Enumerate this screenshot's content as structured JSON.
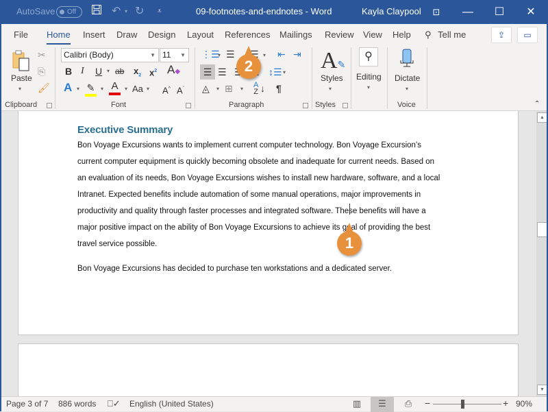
{
  "titlebar": {
    "autosave_label": "AutoSave",
    "autosave_state": "Off",
    "document_title": "09-footnotes-and-endnotes - Word",
    "user_name": "Kayla Claypool",
    "icons": [
      "save-icon",
      "undo-icon",
      "redo-icon",
      "customize-qat-icon",
      "ribbon-display-icon",
      "minimize-icon",
      "maximize-icon",
      "close-icon"
    ]
  },
  "tabs": [
    {
      "label": "File"
    },
    {
      "label": "Home",
      "active": true
    },
    {
      "label": "Insert"
    },
    {
      "label": "Draw"
    },
    {
      "label": "Design"
    },
    {
      "label": "Layout"
    },
    {
      "label": "References"
    },
    {
      "label": "Mailings"
    },
    {
      "label": "Review"
    },
    {
      "label": "View"
    },
    {
      "label": "Help"
    }
  ],
  "tell_me": "Tell me",
  "ribbon": {
    "clipboard": {
      "label": "Clipboard",
      "paste": "Paste"
    },
    "font": {
      "label": "Font",
      "font_name": "Calibri (Body)",
      "font_size": "11",
      "change_case": "Aa"
    },
    "paragraph": {
      "label": "Paragraph"
    },
    "styles": {
      "label": "Styles",
      "button": "Styles"
    },
    "editing": {
      "button": "Editing"
    },
    "voice": {
      "label": "Voice",
      "button": "Dictate"
    }
  },
  "document": {
    "heading": "Executive Summary",
    "lines": [
      "Bon Voyage Excursions wants to implement current computer technology. Bon Voyage Excursion’s",
      "current computer equipment is quickly becoming obsolete and inadequate for current needs. Based on",
      "an evaluation of its needs, Bon Voyage Excursions wishes to install new hardware, software, and a local",
      "Intranet. Expected benefits include automation of some manual operations, major improvements in",
      "productivity and quality through faster processes and integrated software. These benefits will have a",
      "major positive impact on the ability of Bon Voyage Excursions to achieve its goal of providing the best",
      "travel service possible."
    ],
    "paragraph2": "Bon Voyage Excursions has decided to purchase ten workstations and a dedicated server."
  },
  "callouts": {
    "one": "1",
    "two": "2"
  },
  "statusbar": {
    "page": "Page 3 of 7",
    "words": "886 words",
    "language": "English (United States)",
    "zoom_minus": "−",
    "zoom_plus": "+",
    "zoom_level": "90%"
  },
  "colors": {
    "accent": "#2b579a",
    "callout": "#e8913c",
    "heading": "#2a6f8f"
  }
}
